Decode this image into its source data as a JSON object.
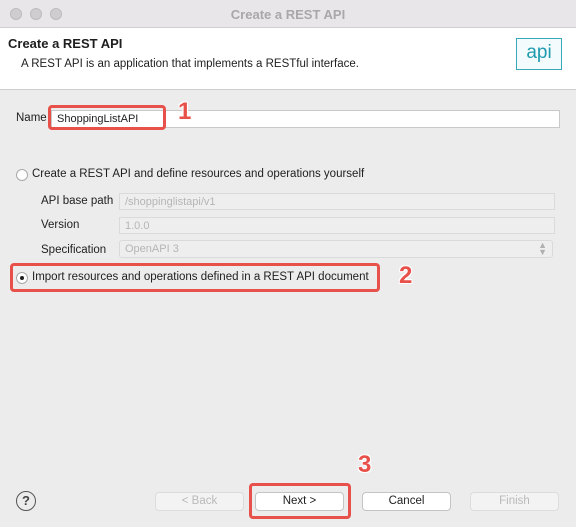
{
  "window": {
    "title": "Create a REST API"
  },
  "header": {
    "title": "Create a REST API",
    "description": "A REST API is an application that implements a RESTful interface.",
    "icon_text": "api"
  },
  "form": {
    "name_label": "Name",
    "name_value": "ShoppingListAPI",
    "option_define": {
      "label": "Create a REST API and define resources and operations yourself",
      "selected": false
    },
    "api_base_path": {
      "label": "API base path",
      "placeholder": "/shoppinglistapi/v1"
    },
    "version": {
      "label": "Version",
      "placeholder": "1.0.0"
    },
    "specification": {
      "label": "Specification",
      "value": "OpenAPI 3"
    },
    "option_import": {
      "label": "Import resources and operations defined in a REST API document",
      "selected": true
    }
  },
  "annotations": {
    "step1": "1",
    "step2": "2",
    "step3": "3",
    "highlight_color": "#e8514a"
  },
  "footer": {
    "help_label": "?",
    "back_label": "< Back",
    "next_label": "Next >",
    "cancel_label": "Cancel",
    "finish_label": "Finish"
  }
}
